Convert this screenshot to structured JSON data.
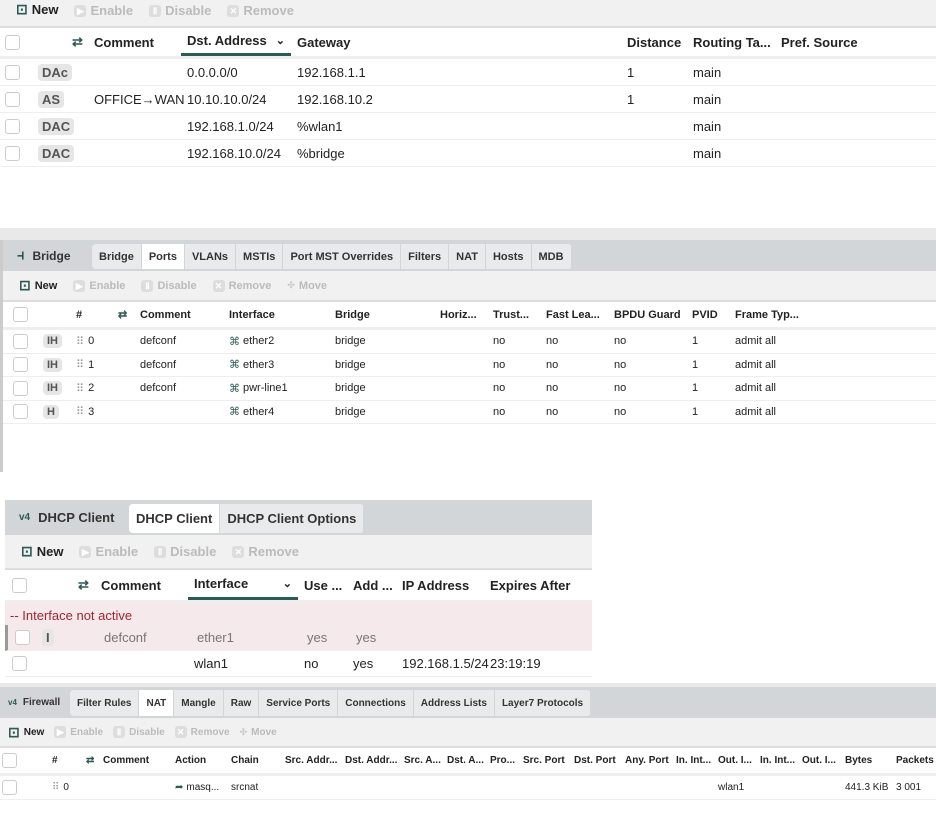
{
  "routes": {
    "toolbar": {
      "new": "New",
      "enable": "Enable",
      "disable": "Disable",
      "remove": "Remove"
    },
    "columns": [
      "",
      "",
      "",
      "Comment",
      "Dst. Address",
      "Gateway",
      "Distance",
      "Routing Ta...",
      "Pref. Source"
    ],
    "rows": [
      [
        "",
        "DAc",
        "",
        "",
        "0.0.0.0/0",
        "192.168.1.1",
        "1",
        "main",
        ""
      ],
      [
        "",
        "AS",
        "",
        "OFFICE→WAN",
        "10.10.10.0/24",
        "192.168.10.2",
        "1",
        "main",
        ""
      ],
      [
        "",
        "DAC",
        "",
        "",
        "192.168.1.0/24",
        "%wlan1",
        "",
        "main",
        ""
      ],
      [
        "",
        "DAC",
        "",
        "",
        "192.168.10.0/24",
        "%bridge",
        "",
        "main",
        ""
      ]
    ]
  },
  "bridge": {
    "title": "Bridge",
    "tabs": [
      "Bridge",
      "Ports",
      "VLANs",
      "MSTIs",
      "Port MST Overrides",
      "Filters",
      "NAT",
      "Hosts",
      "MDB"
    ],
    "active_tab": "Ports",
    "toolbar": {
      "new": "New",
      "enable": "Enable",
      "disable": "Disable",
      "remove": "Remove",
      "move": "Move"
    },
    "columns": [
      "",
      "",
      "#",
      "",
      "Comment",
      "Interface",
      "Bridge",
      "Horiz...",
      "Trust...",
      "Fast Lea...",
      "BPDU Guard",
      "PVID",
      "Frame Typ..."
    ],
    "rows": [
      [
        "",
        "IH",
        "0",
        "",
        "defconf",
        "ether2",
        "bridge",
        "",
        "no",
        "no",
        "no",
        "1",
        "admit all"
      ],
      [
        "",
        "IH",
        "1",
        "",
        "defconf",
        "ether3",
        "bridge",
        "",
        "no",
        "no",
        "no",
        "1",
        "admit all"
      ],
      [
        "",
        "IH",
        "2",
        "",
        "defconf",
        "pwr-line1",
        "bridge",
        "",
        "no",
        "no",
        "no",
        "1",
        "admit all"
      ],
      [
        "",
        "H",
        "3",
        "",
        "",
        "ether4",
        "bridge",
        "",
        "no",
        "no",
        "no",
        "1",
        "admit all"
      ]
    ]
  },
  "dhcp": {
    "title": "DHCP Client",
    "tabs": [
      "DHCP Client",
      "DHCP Client Options"
    ],
    "active_tab": "DHCP Client",
    "toolbar": {
      "new": "New",
      "enable": "Enable",
      "disable": "Disable",
      "remove": "Remove"
    },
    "columns": [
      "",
      "",
      "",
      "Comment",
      "Interface",
      "Use ...",
      "Add ...",
      "IP Address",
      "Expires After"
    ],
    "group_label": "-- Interface not active",
    "rows": [
      [
        "",
        "I",
        "",
        "defconf",
        "ether1",
        "yes",
        "yes",
        "",
        ""
      ],
      [
        "",
        "",
        "",
        "",
        "wlan1",
        "no",
        "yes",
        "192.168.1.5/24",
        "23:19:19"
      ]
    ]
  },
  "firewall": {
    "title": "Firewall",
    "tabs": [
      "Filter Rules",
      "NAT",
      "Mangle",
      "Raw",
      "Service Ports",
      "Connections",
      "Address Lists",
      "Layer7 Protocols"
    ],
    "active_tab": "NAT",
    "toolbar": {
      "new": "New",
      "enable": "Enable",
      "disable": "Disable",
      "remove": "Remove",
      "move": "Move"
    },
    "columns": [
      "",
      "#",
      "",
      "Comment",
      "Action",
      "Chain",
      "Src. Addr...",
      "Dst. Addr...",
      "Src. A...",
      "Dst. A...",
      "Pro...",
      "Src. Port",
      "Dst. Port",
      "Any. Port",
      "In. Int...",
      "Out. I...",
      "In. Int...",
      "Out. I...",
      "Bytes",
      "Packets"
    ],
    "rows": [
      [
        "",
        "0",
        "",
        "",
        "masq...",
        "srcnat",
        "",
        "",
        "",
        "",
        "",
        "",
        "",
        "",
        "",
        "wlan1",
        "",
        "",
        "441.3 KiB",
        "3 001"
      ]
    ]
  }
}
